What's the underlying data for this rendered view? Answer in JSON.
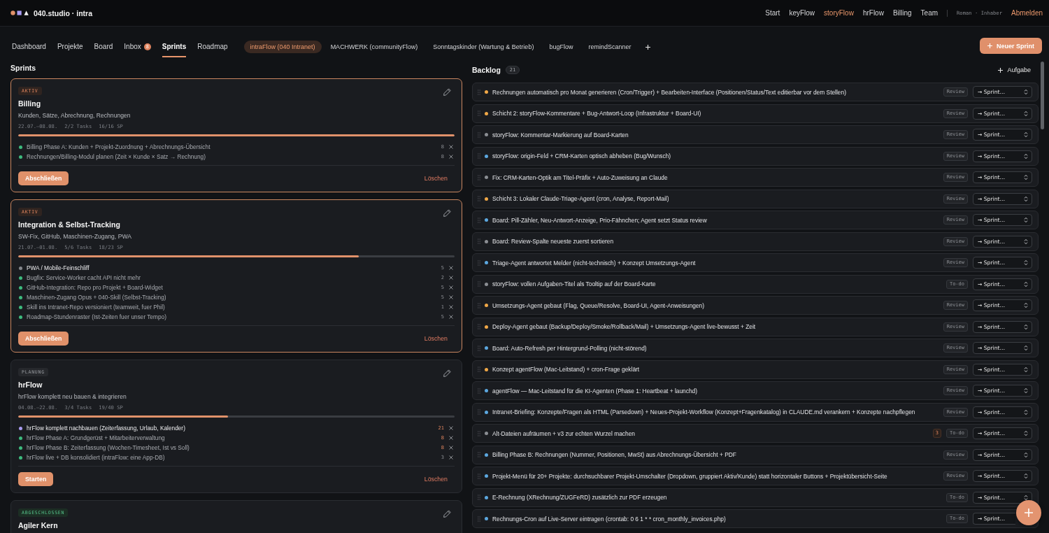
{
  "header": {
    "brand": "040.studio · intra",
    "nav": [
      {
        "label": "Start",
        "selected": false
      },
      {
        "label": "keyFlow",
        "selected": false
      },
      {
        "label": "storyFlow",
        "selected": true
      },
      {
        "label": "hrFlow",
        "selected": false
      },
      {
        "label": "Billing",
        "selected": false
      },
      {
        "label": "Team",
        "selected": false
      }
    ],
    "user": "Roman · Inhaber",
    "logout": "Abmelden"
  },
  "tabs": [
    {
      "label": "Dashboard",
      "selected": false
    },
    {
      "label": "Projekte",
      "selected": false
    },
    {
      "label": "Board",
      "selected": false
    },
    {
      "label": "Inbox",
      "selected": false,
      "badge": "8"
    },
    {
      "label": "Sprints",
      "selected": true
    },
    {
      "label": "Roadmap",
      "selected": false
    }
  ],
  "projects": [
    {
      "label": "intraFlow (040 Intranet)",
      "selected": true
    },
    {
      "label": "MACHWERK (communityFlow)",
      "selected": false
    },
    {
      "label": "Sonntagskinder (Wartung & Betrieb)",
      "selected": false
    },
    {
      "label": "bugFlow",
      "selected": false
    },
    {
      "label": "remindScanner",
      "selected": false
    }
  ],
  "new_sprint_button": "Neuer Sprint",
  "sprints": {
    "title": "Sprints",
    "items": [
      {
        "kind": "active",
        "badge": "AKTIV",
        "title": "Billing",
        "subtitle": "Kunden, Sätze, Abrechnung, Rechnungen",
        "dates": "22.07.–08.08.",
        "task_count": "2/2 Tasks",
        "story_points": "16/16 SP",
        "level": 1,
        "tasks": [
          {
            "title": "Billing Phase A: Kunden + Projekt-Zuordnung + Abrechnungs-Übersicht",
            "color": "#3dbb7e",
            "done": true,
            "points": "8",
            "flagged": false
          },
          {
            "title": "Rechnungen/Billing-Modul planen (Zeit × Kunde × Satz → Rechnung)",
            "color": "#3dbb7e",
            "done": true,
            "points": "8",
            "flagged": false
          }
        ],
        "primary_action": "Abschließen",
        "delete_action": "Löschen"
      },
      {
        "kind": "active",
        "badge": "AKTIV",
        "title": "Integration & Selbst-Tracking",
        "subtitle": "SW-Fix, GitHub, Maschinen-Zugang, PWA",
        "dates": "21.07.–01.08.",
        "task_count": "5/6 Tasks",
        "story_points": "18/23 SP",
        "level": 0.78,
        "tasks": [
          {
            "title": "PWA / Mobile-Feinschliff",
            "color": "#85888d",
            "done": false,
            "points": "5",
            "flagged": false
          },
          {
            "title": "Bugfix: Service-Worker cacht API nicht mehr",
            "color": "#3dbb7e",
            "done": true,
            "points": "2",
            "flagged": false
          },
          {
            "title": "GitHub-Integration: Repo pro Projekt + Board-Widget",
            "color": "#3dbb7e",
            "done": true,
            "points": "5",
            "flagged": false
          },
          {
            "title": "Maschinen-Zugang Opus + 040-Skill (Selbst-Tracking)",
            "color": "#3dbb7e",
            "done": true,
            "points": "5",
            "flagged": false
          },
          {
            "title": "Skill ins Intranet-Repo versioniert (teamweit, fuer Phil)",
            "color": "#3dbb7e",
            "done": true,
            "points": "1",
            "flagged": false
          },
          {
            "title": "Roadmap-Stundenraster (Ist-Zeiten fuer unser Tempo)",
            "color": "#3dbb7e",
            "done": true,
            "points": "5",
            "flagged": false
          }
        ],
        "primary_action": "Abschließen",
        "delete_action": "Löschen"
      },
      {
        "kind": "planned",
        "badge": "PLANUNG",
        "title": "hrFlow",
        "subtitle": "hrFlow komplett neu bauen & integrieren",
        "dates": "04.08.–22.08.",
        "task_count": "3/4 Tasks",
        "story_points": "19/40 SP",
        "level": 0.48,
        "tasks": [
          {
            "title": "hrFlow komplett nachbauen (Zeiterfassung, Urlaub, Kalender)",
            "color": "#a99cf2",
            "done": false,
            "points": "21",
            "flagged": true
          },
          {
            "title": "hrFlow Phase A: Grundgerüst + Mitarbeiterverwaltung",
            "color": "#3dbb7e",
            "done": true,
            "points": "8",
            "flagged": true
          },
          {
            "title": "hrFlow Phase B: Zeiterfassung (Wochen-Timesheet, Ist vs Soll)",
            "color": "#3dbb7e",
            "done": true,
            "points": "8",
            "flagged": true
          },
          {
            "title": "hrFlow live + DB konsolidiert (intraFlow: eine App-DB)",
            "color": "#3dbb7e",
            "done": true,
            "points": "3",
            "flagged": false
          }
        ],
        "primary_action": "Starten",
        "delete_action": "Löschen"
      },
      {
        "kind": "done",
        "badge": "ABGESCHLOSSEN",
        "title": "Agiler Kern"
      }
    ]
  },
  "backlog": {
    "title": "Backlog",
    "count": "21",
    "add_button": "Aufgabe",
    "items": [
      {
        "title": "Rechnungen automatisch pro Monat generieren (Cron/Trigger) + Bearbeiten-Interface (Positionen/Status/Text editierbar vor dem Stellen)",
        "color": "#f0a847",
        "status": "Review",
        "sprint_select": "→ Sprint…"
      },
      {
        "title": "Schicht 2: storyFlow-Kommentare + Bug-Antwort-Loop (Infrastruktur + Board-UI)",
        "color": "#f0a847",
        "status": "Review",
        "sprint_select": "→ Sprint…"
      },
      {
        "title": "storyFlow: Kommentar-Markierung auf Board-Karten",
        "color": "#8b8e93",
        "status": "Review",
        "sprint_select": "→ Sprint…"
      },
      {
        "title": "storyFlow: origin-Feld + CRM-Karten optisch abheben (Bug/Wunsch)",
        "color": "#5ca8e0",
        "status": "Review",
        "sprint_select": "→ Sprint…"
      },
      {
        "title": "Fix: CRM-Karten-Optik am Titel-Präfix + Auto-Zuweisung an Claude",
        "color": "#8b8e93",
        "status": "Review",
        "sprint_select": "→ Sprint…"
      },
      {
        "title": "Schicht 3: Lokaler Claude-Triage-Agent (cron, Analyse, Report-Mail)",
        "color": "#f0a847",
        "status": "Review",
        "sprint_select": "→ Sprint…"
      },
      {
        "title": "Board: Pill-Zähler, Neu-Antwort-Anzeige, Prio-Fähnchen; Agent setzt Status review",
        "color": "#5ca8e0",
        "status": "Review",
        "sprint_select": "→ Sprint…"
      },
      {
        "title": "Board: Review-Spalte neueste zuerst sortieren",
        "color": "#8b8e93",
        "status": "Review",
        "sprint_select": "→ Sprint…"
      },
      {
        "title": "Triage-Agent antwortet Melder (nicht-technisch) + Konzept Umsetzungs-Agent",
        "color": "#5ca8e0",
        "status": "Review",
        "sprint_select": "→ Sprint…"
      },
      {
        "title": "storyFlow: vollen Aufgaben-Titel als Tooltip auf der Board-Karte",
        "color": "#8b8e93",
        "status": "To-do",
        "sprint_select": "→ Sprint…"
      },
      {
        "title": "Umsetzungs-Agent gebaut (Flag, Queue/Resolve, Board-UI, Agent-Anweisungen)",
        "color": "#f0a847",
        "status": "Review",
        "sprint_select": "→ Sprint…"
      },
      {
        "title": "Deploy-Agent gebaut (Backup/Deploy/Smoke/Rollback/Mail) + Umsetzungs-Agent live-bewusst + Zeit",
        "color": "#f0a847",
        "status": "Review",
        "sprint_select": "→ Sprint…"
      },
      {
        "title": "Board: Auto-Refresh per Hintergrund-Polling (nicht-störend)",
        "color": "#5ca8e0",
        "status": "Review",
        "sprint_select": "→ Sprint…"
      },
      {
        "title": "Konzept agentFlow (Mac-Leitstand) + cron-Frage geklärt",
        "color": "#f0a847",
        "status": "Review",
        "sprint_select": "→ Sprint…"
      },
      {
        "title": "agentFlow — Mac-Leitstand für die KI-Agenten (Phase 1: Heartbeat + launchd)",
        "color": "#5ca8e0",
        "status": "Review",
        "sprint_select": "→ Sprint…"
      },
      {
        "title": "Intranet-Briefing: Konzepte/Fragen als HTML (Parsedown) + Neues-Projekt-Workflow (Konzept+Fragenkatalog) in CLAUDE.md verankern + Konzepte nachpflegen",
        "color": "#5ca8e0",
        "status": "Review",
        "sprint_select": "→ Sprint…"
      },
      {
        "title": "Alt-Dateien aufräumen + v3 zur echten Wurzel machen",
        "color": "#8b8e93",
        "count": "3",
        "status": "To-do",
        "sprint_select": "→ Sprint…"
      },
      {
        "title": "Billing Phase B: Rechnungen (Nummer, Positionen, MwSt) aus Abrechnungs-Übersicht + PDF",
        "color": "#5ca8e0",
        "status": "Review",
        "sprint_select": "→ Sprint…"
      },
      {
        "title": "Projekt-Menü für 20+ Projekte: durchsuchbarer Projekt-Umschalter (Dropdown, gruppiert Aktiv/Kunde) statt horizontaler Buttons + Projektübersicht-Seite",
        "color": "#5ca8e0",
        "status": "Review",
        "sprint_select": "→ Sprint…"
      },
      {
        "title": "E-Rechnung (XRechnung/ZUGFeRD) zusätzlich zur PDF erzeugen",
        "color": "#5ca8e0",
        "status": "To-do",
        "sprint_select": "→ Sprint…"
      },
      {
        "title": "Rechnungs-Cron auf Live-Server eintragen (crontab: 0 6 1 * * cron_monthly_invoices.php)",
        "color": "#5ca8e0",
        "status": "To-do",
        "sprint_select": "→ Sprint…"
      }
    ]
  }
}
